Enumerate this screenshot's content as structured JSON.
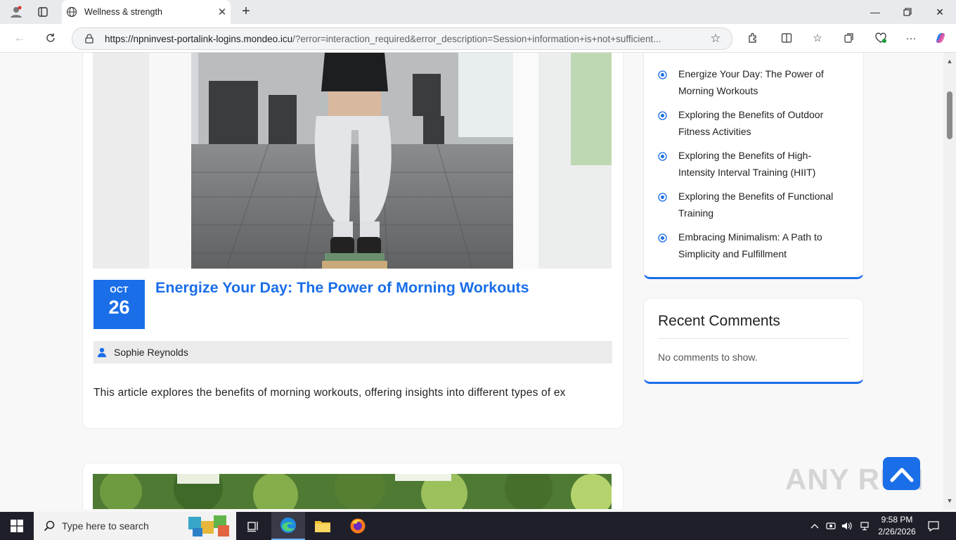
{
  "browser": {
    "tab_title": "Wellness & strength",
    "url_host": "https://npninvest-portalink-logins.mondeo.icu",
    "url_rest": "/?error=interaction_required&error_description=Session+information+is+not+sufficient..."
  },
  "post": {
    "date_month": "OCT",
    "date_day": "26",
    "title": "Energize Your Day: The Power of Morning Workouts",
    "author": "Sophie Reynolds",
    "excerpt": "This article explores the benefits of morning workouts, offering insights into different types of ex"
  },
  "sidebar": {
    "recent_posts": [
      {
        "line1": "Energize Your Day: The Power of",
        "line2": "Morning Workouts"
      },
      {
        "line1": "Exploring the Benefits of Outdoor",
        "line2": "Fitness Activities"
      },
      {
        "line1": "Exploring the Benefits of High-",
        "line2": "Intensity Interval Training (HIIT)"
      },
      {
        "line1": "Exploring the Benefits of Functional",
        "line2": "Training"
      },
      {
        "line1": "Embracing Minimalism: A Path to",
        "line2": "Simplicity and Fulfillment"
      }
    ],
    "comments_title": "Recent Comments",
    "comments_empty": "No comments to show."
  },
  "watermark": "ANY RUN",
  "taskbar": {
    "search_placeholder": "Type here to search",
    "time": "9:58 PM",
    "date": "2/26/2026"
  },
  "colors": {
    "accent": "#1a6ee8",
    "taskbar": "#1f1f2a"
  }
}
